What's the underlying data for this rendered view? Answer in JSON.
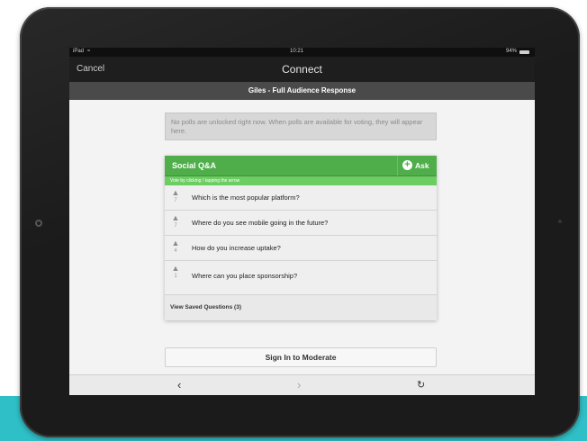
{
  "statusbar": {
    "carrier": "iPad",
    "wifi": "≈",
    "time": "10:21",
    "battery": "94%"
  },
  "navbar": {
    "cancel_label": "Cancel",
    "title": "Connect"
  },
  "subheader": {
    "title": "Giles - Full Audience Response"
  },
  "notice": {
    "text": "No polls are unlocked right now. When polls are available for voting, they will appear here."
  },
  "social": {
    "title": "Social Q&A",
    "ask_label": "Ask",
    "ask_icon_glyph": "+",
    "instruction": "Vote by clicking / tapping the arrow",
    "questions": [
      {
        "text": "Which is the most popular platform?",
        "votes": "7"
      },
      {
        "text": "Where do you see mobile going in the future?",
        "votes": "7"
      },
      {
        "text": "How do you increase uptake?",
        "votes": "4"
      },
      {
        "text": "Where can you place sponsorship?",
        "votes": "1"
      }
    ],
    "saved_label": "View Saved Questions (3)"
  },
  "signin_label": "Sign In to Moderate",
  "toolbar": {
    "back_glyph": "‹",
    "forward_glyph": "›",
    "refresh_glyph": "↻"
  },
  "icons": {
    "vote_arrow": "▲"
  },
  "colors": {
    "accent_green": "#4fae4a",
    "light_green": "#6ccd62",
    "teal_band": "#2fbfc6"
  }
}
